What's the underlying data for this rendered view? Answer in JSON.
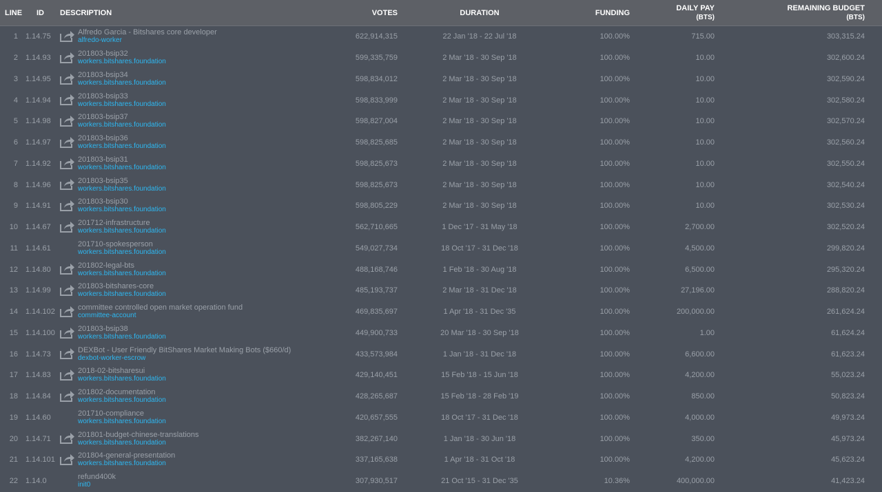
{
  "headers": {
    "line": "LINE",
    "id": "ID",
    "description": "DESCRIPTION",
    "votes": "VOTES",
    "duration": "DURATION",
    "funding": "FUNDING",
    "daily_pay": "DAILY PAY",
    "daily_pay_unit": "(BTS)",
    "remaining_budget": "REMAINING BUDGET",
    "remaining_budget_unit": "(BTS)"
  },
  "colors": {
    "background": "#4b515b",
    "header": "#5d6066",
    "text": "#9aa0a8",
    "account_link": "#2db8f2"
  },
  "rows": [
    {
      "line": "1",
      "id": "1.14.75",
      "title": "Alfredo Garcia - Bitshares core developer",
      "account": "alfredo-worker",
      "has_link": true,
      "votes": "622,914,315",
      "duration": "22 Jan '18 - 22 Jul '18",
      "funding": "100.00%",
      "daily_pay": "715.00",
      "remaining": "303,315.24"
    },
    {
      "line": "2",
      "id": "1.14.93",
      "title": "201803-bsip32",
      "account": "workers.bitshares.foundation",
      "has_link": true,
      "votes": "599,335,759",
      "duration": "2 Mar '18 - 30 Sep '18",
      "funding": "100.00%",
      "daily_pay": "10.00",
      "remaining": "302,600.24"
    },
    {
      "line": "3",
      "id": "1.14.95",
      "title": "201803-bsip34",
      "account": "workers.bitshares.foundation",
      "has_link": true,
      "votes": "598,834,012",
      "duration": "2 Mar '18 - 30 Sep '18",
      "funding": "100.00%",
      "daily_pay": "10.00",
      "remaining": "302,590.24"
    },
    {
      "line": "4",
      "id": "1.14.94",
      "title": "201803-bsip33",
      "account": "workers.bitshares.foundation",
      "has_link": true,
      "votes": "598,833,999",
      "duration": "2 Mar '18 - 30 Sep '18",
      "funding": "100.00%",
      "daily_pay": "10.00",
      "remaining": "302,580.24"
    },
    {
      "line": "5",
      "id": "1.14.98",
      "title": "201803-bsip37",
      "account": "workers.bitshares.foundation",
      "has_link": true,
      "votes": "598,827,004",
      "duration": "2 Mar '18 - 30 Sep '18",
      "funding": "100.00%",
      "daily_pay": "10.00",
      "remaining": "302,570.24"
    },
    {
      "line": "6",
      "id": "1.14.97",
      "title": "201803-bsip36",
      "account": "workers.bitshares.foundation",
      "has_link": true,
      "votes": "598,825,685",
      "duration": "2 Mar '18 - 30 Sep '18",
      "funding": "100.00%",
      "daily_pay": "10.00",
      "remaining": "302,560.24"
    },
    {
      "line": "7",
      "id": "1.14.92",
      "title": "201803-bsip31",
      "account": "workers.bitshares.foundation",
      "has_link": true,
      "votes": "598,825,673",
      "duration": "2 Mar '18 - 30 Sep '18",
      "funding": "100.00%",
      "daily_pay": "10.00",
      "remaining": "302,550.24"
    },
    {
      "line": "8",
      "id": "1.14.96",
      "title": "201803-bsip35",
      "account": "workers.bitshares.foundation",
      "has_link": true,
      "votes": "598,825,673",
      "duration": "2 Mar '18 - 30 Sep '18",
      "funding": "100.00%",
      "daily_pay": "10.00",
      "remaining": "302,540.24"
    },
    {
      "line": "9",
      "id": "1.14.91",
      "title": "201803-bsip30",
      "account": "workers.bitshares.foundation",
      "has_link": true,
      "votes": "598,805,229",
      "duration": "2 Mar '18 - 30 Sep '18",
      "funding": "100.00%",
      "daily_pay": "10.00",
      "remaining": "302,530.24"
    },
    {
      "line": "10",
      "id": "1.14.67",
      "title": "201712-infrastructure",
      "account": "workers.bitshares.foundation",
      "has_link": true,
      "votes": "562,710,665",
      "duration": "1 Dec '17 - 31 May '18",
      "funding": "100.00%",
      "daily_pay": "2,700.00",
      "remaining": "302,520.24"
    },
    {
      "line": "11",
      "id": "1.14.61",
      "title": "201710-spokesperson",
      "account": "workers.bitshares.foundation",
      "has_link": false,
      "votes": "549,027,734",
      "duration": "18 Oct '17 - 31 Dec '18",
      "funding": "100.00%",
      "daily_pay": "4,500.00",
      "remaining": "299,820.24"
    },
    {
      "line": "12",
      "id": "1.14.80",
      "title": "201802-legal-bts",
      "account": "workers.bitshares.foundation",
      "has_link": true,
      "votes": "488,168,746",
      "duration": "1 Feb '18 - 30 Aug '18",
      "funding": "100.00%",
      "daily_pay": "6,500.00",
      "remaining": "295,320.24"
    },
    {
      "line": "13",
      "id": "1.14.99",
      "title": "201803-bitshares-core",
      "account": "workers.bitshares.foundation",
      "has_link": true,
      "votes": "485,193,737",
      "duration": "2 Mar '18 - 31 Dec '18",
      "funding": "100.00%",
      "daily_pay": "27,196.00",
      "remaining": "288,820.24"
    },
    {
      "line": "14",
      "id": "1.14.102",
      "title": "committee controlled open market operation fund",
      "account": "committee-account",
      "has_link": true,
      "votes": "469,835,697",
      "duration": "1 Apr '18 - 31 Dec '35",
      "funding": "100.00%",
      "daily_pay": "200,000.00",
      "remaining": "261,624.24"
    },
    {
      "line": "15",
      "id": "1.14.100",
      "title": "201803-bsip38",
      "account": "workers.bitshares.foundation",
      "has_link": true,
      "votes": "449,900,733",
      "duration": "20 Mar '18 - 30 Sep '18",
      "funding": "100.00%",
      "daily_pay": "1.00",
      "remaining": "61,624.24"
    },
    {
      "line": "16",
      "id": "1.14.73",
      "title": "DEXBot - User Friendly BitShares Market Making Bots ($660/d)",
      "account": "dexbot-worker-escrow",
      "has_link": true,
      "votes": "433,573,984",
      "duration": "1 Jan '18 - 31 Dec '18",
      "funding": "100.00%",
      "daily_pay": "6,600.00",
      "remaining": "61,623.24"
    },
    {
      "line": "17",
      "id": "1.14.83",
      "title": "2018-02-bitsharesui",
      "account": "workers.bitshares.foundation",
      "has_link": true,
      "votes": "429,140,451",
      "duration": "15 Feb '18 - 15 Jun '18",
      "funding": "100.00%",
      "daily_pay": "4,200.00",
      "remaining": "55,023.24"
    },
    {
      "line": "18",
      "id": "1.14.84",
      "title": "201802-documentation",
      "account": "workers.bitshares.foundation",
      "has_link": true,
      "votes": "428,265,687",
      "duration": "15 Feb '18 - 28 Feb '19",
      "funding": "100.00%",
      "daily_pay": "850.00",
      "remaining": "50,823.24"
    },
    {
      "line": "19",
      "id": "1.14.60",
      "title": "201710-compliance",
      "account": "workers.bitshares.foundation",
      "has_link": false,
      "votes": "420,657,555",
      "duration": "18 Oct '17 - 31 Dec '18",
      "funding": "100.00%",
      "daily_pay": "4,000.00",
      "remaining": "49,973.24"
    },
    {
      "line": "20",
      "id": "1.14.71",
      "title": "201801-budget-chinese-translations",
      "account": "workers.bitshares.foundation",
      "has_link": true,
      "votes": "382,267,140",
      "duration": "1 Jan '18 - 30 Jun '18",
      "funding": "100.00%",
      "daily_pay": "350.00",
      "remaining": "45,973.24"
    },
    {
      "line": "21",
      "id": "1.14.101",
      "title": "201804-general-presentation",
      "account": "workers.bitshares.foundation",
      "has_link": true,
      "votes": "337,165,638",
      "duration": "1 Apr '18 - 31 Oct '18",
      "funding": "100.00%",
      "daily_pay": "4,200.00",
      "remaining": "45,623.24"
    },
    {
      "line": "22",
      "id": "1.14.0",
      "title": "refund400k",
      "account": "init0",
      "has_link": false,
      "votes": "307,930,517",
      "duration": "21 Oct '15 - 31 Dec '35",
      "funding": "10.36%",
      "daily_pay": "400,000.00",
      "remaining": "41,423.24"
    }
  ]
}
